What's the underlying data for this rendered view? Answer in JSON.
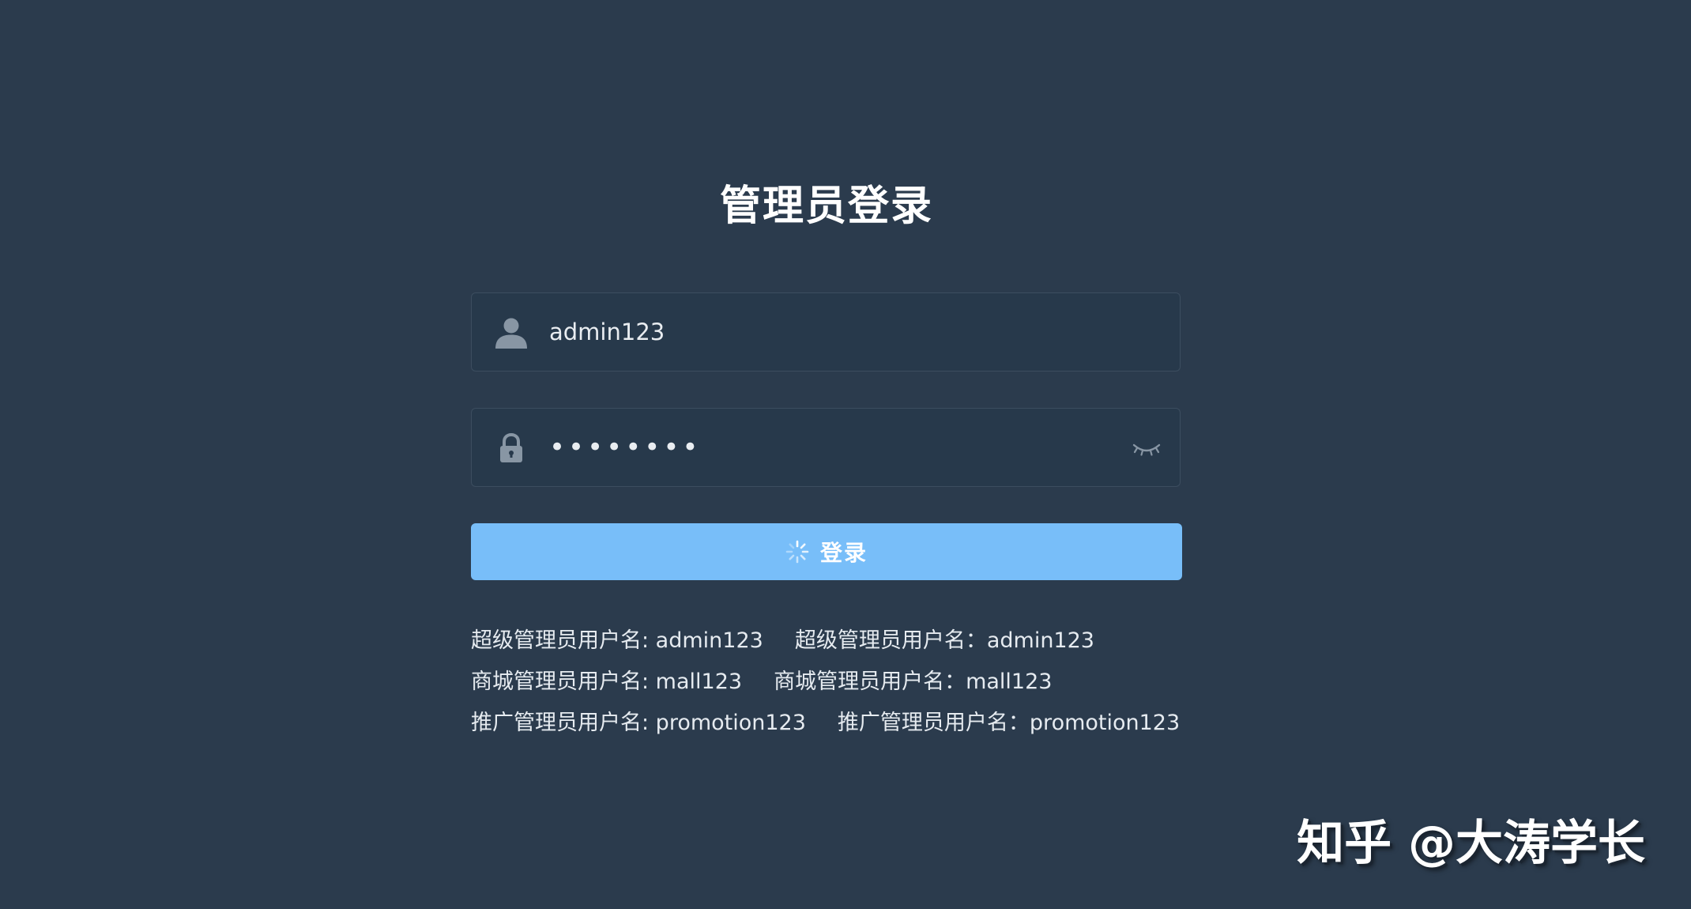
{
  "title": "管理员登录",
  "username": {
    "value": "admin123",
    "icon": "user-icon"
  },
  "password": {
    "value": "••••••••",
    "icon": "lock-icon",
    "toggle_icon": "eye-closed-icon"
  },
  "login_button": {
    "label": "登录",
    "icon": "loading-spinner-icon",
    "color": "#78bef9"
  },
  "hints": [
    [
      "超级管理员用户名: admin123",
      "超级管理员用户名：admin123"
    ],
    [
      "商城管理员用户名: mall123",
      "商城管理员用户名：mall123"
    ],
    [
      "推广管理员用户名: promotion123",
      "推广管理员用户名：promotion123"
    ]
  ],
  "watermark": "知乎 @大涛学长",
  "colors": {
    "background": "#2b3b4d",
    "input_background": "#27394b",
    "input_border": "#3c4d5f"
  }
}
